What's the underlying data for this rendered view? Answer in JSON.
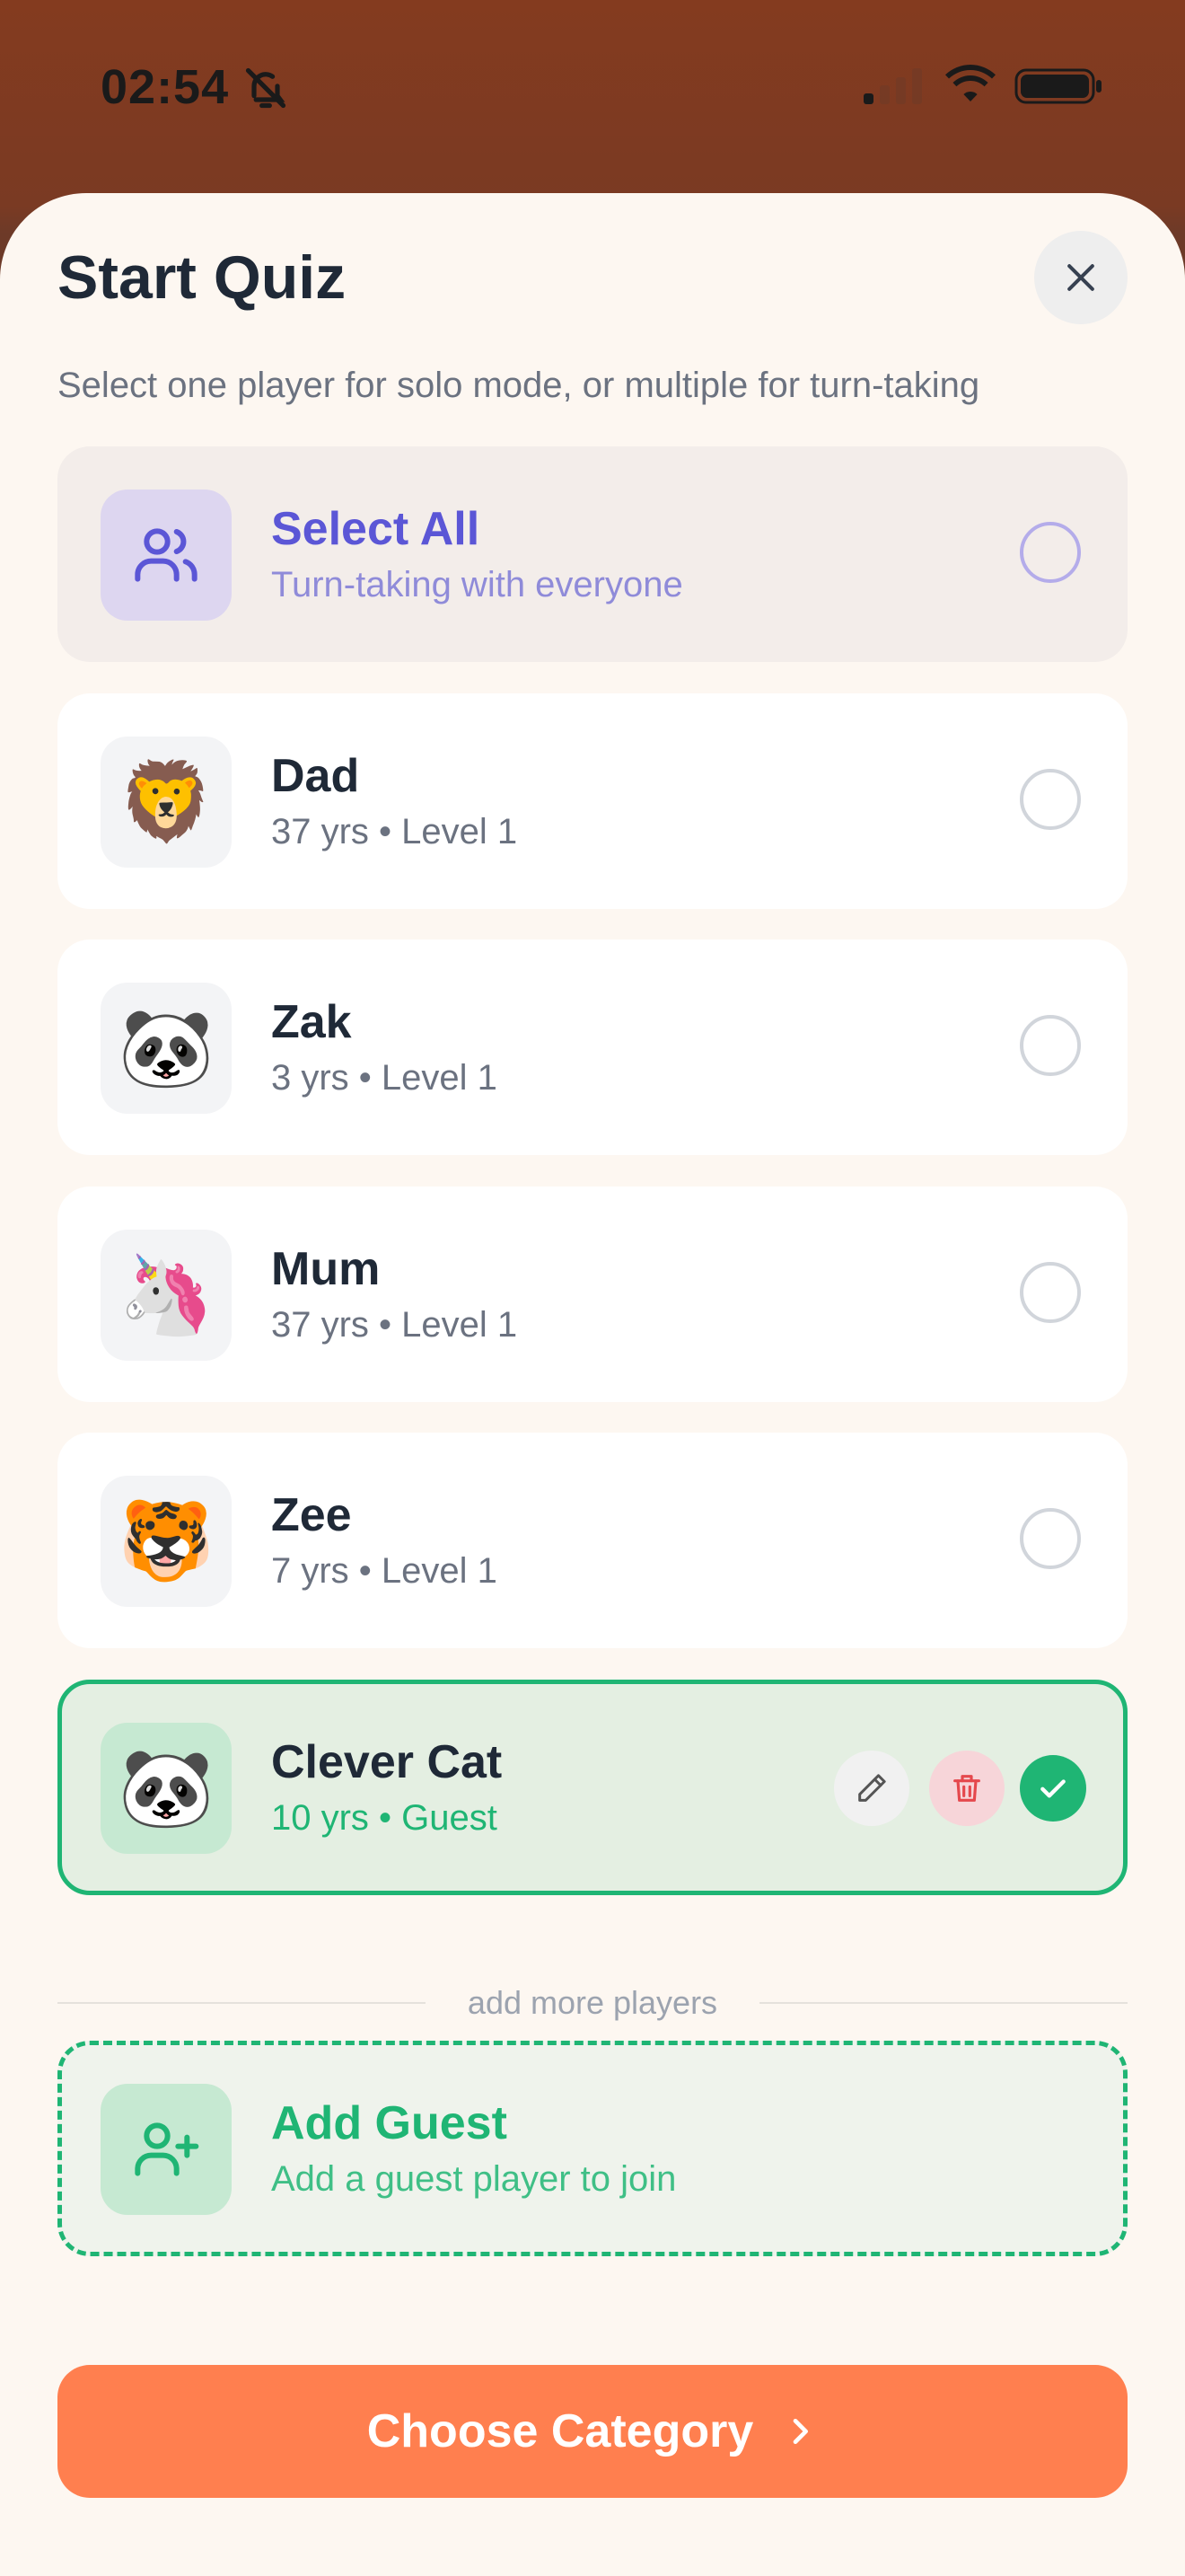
{
  "status": {
    "time": "02:54"
  },
  "sheet": {
    "title": "Start Quiz",
    "subtitle": "Select one player for solo mode, or multiple for turn-taking"
  },
  "select_all": {
    "label": "Select All",
    "sublabel": "Turn-taking with everyone"
  },
  "players": [
    {
      "name": "Dad",
      "meta": "37 yrs • Level 1",
      "emoji": "🦁",
      "selected": false
    },
    {
      "name": "Zak",
      "meta": "3 yrs • Level 1",
      "emoji": "🐼",
      "selected": false
    },
    {
      "name": "Mum",
      "meta": "37 yrs • Level 1",
      "emoji": "🦄",
      "selected": false
    },
    {
      "name": "Zee",
      "meta": "7 yrs • Level 1",
      "emoji": "🐯",
      "selected": false
    },
    {
      "name": "Clever Cat",
      "meta": "10 yrs • Guest",
      "emoji": "🐼",
      "selected": true
    }
  ],
  "divider_label": "add more players",
  "add_guest": {
    "label": "Add Guest",
    "sublabel": "Add a guest player to join"
  },
  "primary_button": {
    "label": "Choose Category"
  },
  "colors": {
    "accent_green": "#1fb574",
    "accent_purple": "#5b56d6",
    "cta_orange": "#ff7f4f",
    "header_brown": "#843b1f"
  },
  "icons": {
    "status": [
      "bell-slash-icon",
      "signal-icon",
      "wifi-icon",
      "battery-icon"
    ],
    "close": "close-icon",
    "select_all": "users-icon",
    "edit": "pencil-icon",
    "delete": "trash-icon",
    "check": "check-icon",
    "add_guest": "user-plus-icon",
    "chevron": "chevron-right-icon"
  }
}
